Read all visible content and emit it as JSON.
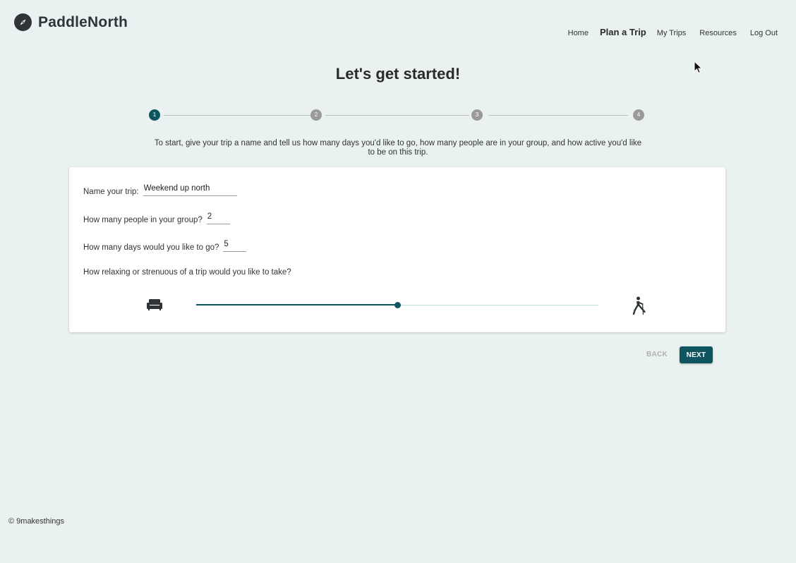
{
  "app": {
    "name": "PaddleNorth"
  },
  "nav": {
    "items": [
      {
        "label": "Home",
        "active": false
      },
      {
        "label": "Plan a Trip",
        "active": true
      },
      {
        "label": "My Trips",
        "active": false
      },
      {
        "label": "Resources",
        "active": false
      },
      {
        "label": "Log Out",
        "active": false
      }
    ]
  },
  "page": {
    "title": "Let's get started!",
    "intro": "To start, give your trip a name and tell us how many days you'd like to go, how many people are in your group, and how active you'd like to be on this trip."
  },
  "stepper": {
    "steps": [
      {
        "label": "1",
        "active": true
      },
      {
        "label": "2",
        "active": false
      },
      {
        "label": "3",
        "active": false
      },
      {
        "label": "4",
        "active": false
      }
    ]
  },
  "form": {
    "trip_name": {
      "label": "Name your trip:",
      "value": "Weekend up north"
    },
    "people": {
      "label": "How many people in your group?",
      "value": "2"
    },
    "days": {
      "label": "How many days would you like to go?",
      "value": "5"
    },
    "activity": {
      "label": "How relaxing or strenuous of a trip would you like to take?",
      "value_fraction": 0.5,
      "min_icon": "sofa-icon",
      "max_icon": "hiking-icon"
    }
  },
  "actions": {
    "back_label": "BACK",
    "next_label": "NEXT"
  },
  "footer": {
    "text": "© 9makesthings"
  },
  "colors": {
    "accent": "#0e5560",
    "background": "#e9f2f1",
    "inactive_step": "#9a9a9a"
  }
}
